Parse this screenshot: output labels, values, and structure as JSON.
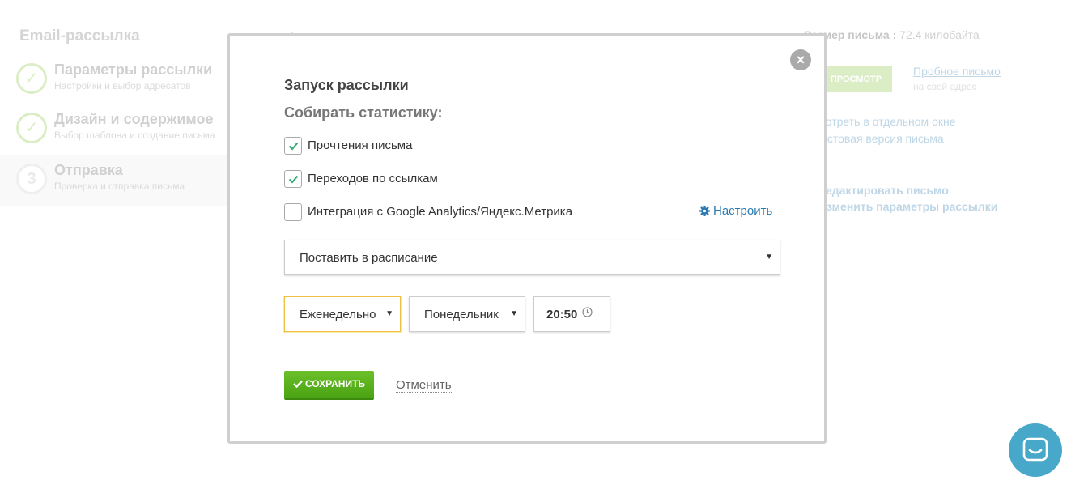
{
  "background": {
    "page_title": "Email-рассылка",
    "steps": [
      {
        "number": "✓",
        "title": "Параметры рассылки",
        "subtitle": "Настройки и выбор адресатов"
      },
      {
        "number": "✓",
        "title": "Дизайн и содержимое",
        "subtitle": "Выбор шаблона и создание письма"
      },
      {
        "number": "3",
        "title": "Отправка",
        "subtitle": "Проверка и отправка письма"
      }
    ],
    "subject_label": "Тема письма:",
    "size_label": "Размер письма :",
    "size_value": "72.4 килобайта",
    "preview_button": "ПРОСМОТР",
    "test_email_link": "Пробное письмо",
    "test_email_sub": "на свой адрес",
    "view_window_link": "Смотреть в отдельном окне",
    "text_version_link": "Текстовая версия письма",
    "edit_letter_link": "Редактировать письмо",
    "edit_params_link": "Изменить параметры рассылки"
  },
  "modal": {
    "title": "Запуск рассылки",
    "stats_label": "Собирать статистику:",
    "checkboxes": [
      {
        "label": "Прочтения письма",
        "checked": true
      },
      {
        "label": "Переходов по ссылкам",
        "checked": true
      },
      {
        "label": "Интеграция с Google Analytics/Яндекс.Метрика",
        "checked": false
      }
    ],
    "setup_link": "Настроить",
    "schedule_select": "Поставить в расписание",
    "frequency_select": "Еженедельно",
    "day_select": "Понедельник",
    "time_value": "20:50",
    "save_button": "СОХРАНИТЬ",
    "cancel_link": "Отменить",
    "close_symbol": "×"
  },
  "colors": {
    "accent_green": "#5ab31e",
    "link_blue": "#2a7ab0",
    "chat_blue": "#47a8c9"
  },
  "icons": {
    "checkbox_checked": "check-icon",
    "setup": "gear-icon",
    "time": "clock-icon",
    "save": "check-icon",
    "chat": "chat-icon"
  }
}
